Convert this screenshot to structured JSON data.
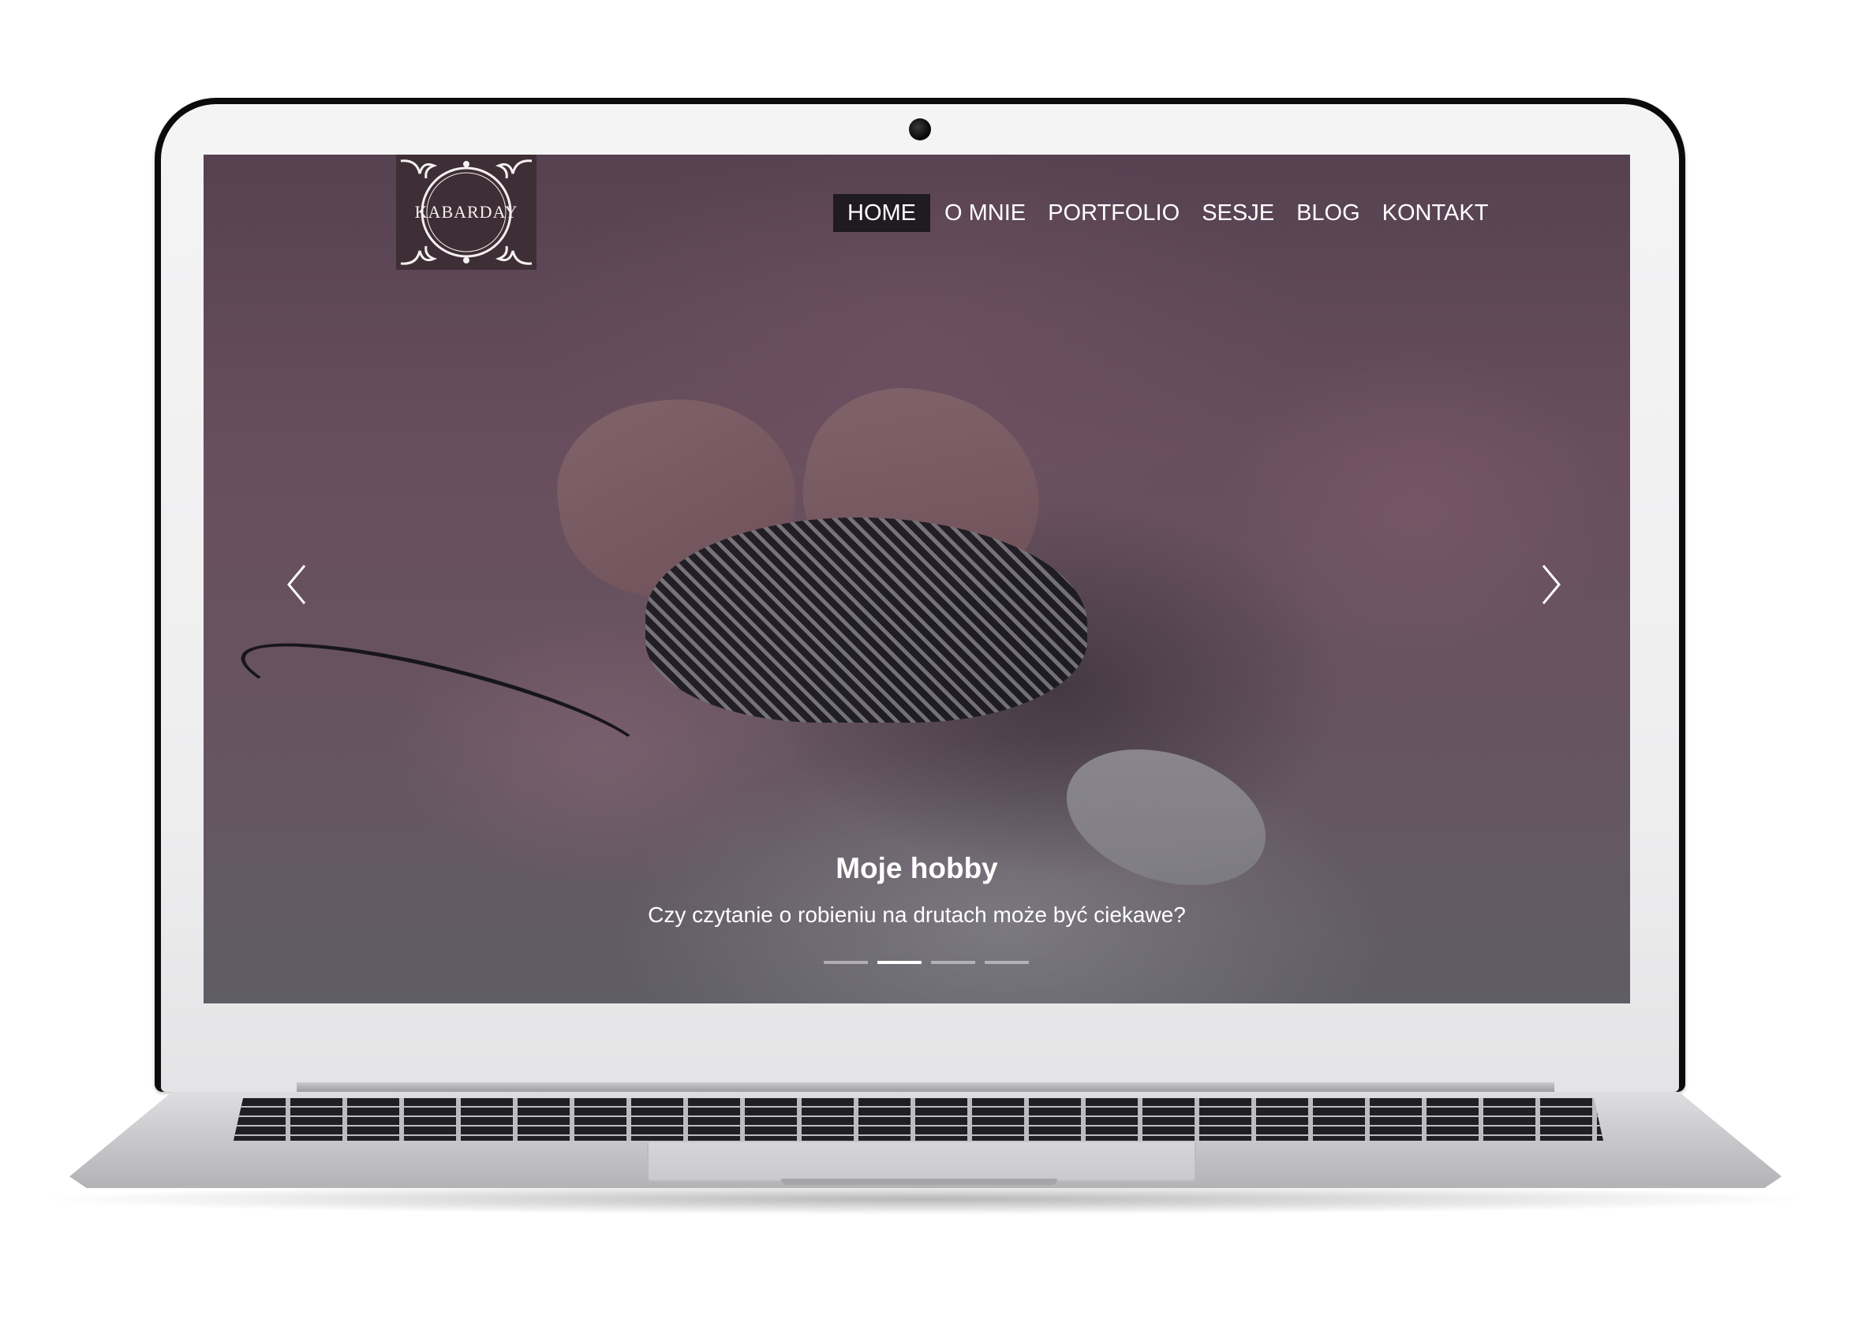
{
  "site": {
    "logo_text": "KABARDAY",
    "nav": {
      "items": [
        {
          "label": "HOME",
          "active": true
        },
        {
          "label": "O MNIE",
          "active": false
        },
        {
          "label": "PORTFOLIO",
          "active": false
        },
        {
          "label": "SESJE",
          "active": false
        },
        {
          "label": "BLOG",
          "active": false
        },
        {
          "label": "KONTAKT",
          "active": false
        }
      ]
    },
    "carousel": {
      "slide_title": "Moje hobby",
      "slide_subtitle": "Czy czytanie o robieniu na drutach może być ciekawe?",
      "slide_count": 4,
      "active_slide": 2,
      "prev_icon": "chevron-left-icon",
      "next_icon": "chevron-right-icon"
    }
  },
  "colors": {
    "nav_active_bg": "#1f1b21",
    "logo_bg": "#3e2e35",
    "text": "#ffffff",
    "laptop_body": "#c6c6c9",
    "bezel": "#f0f0f1"
  }
}
